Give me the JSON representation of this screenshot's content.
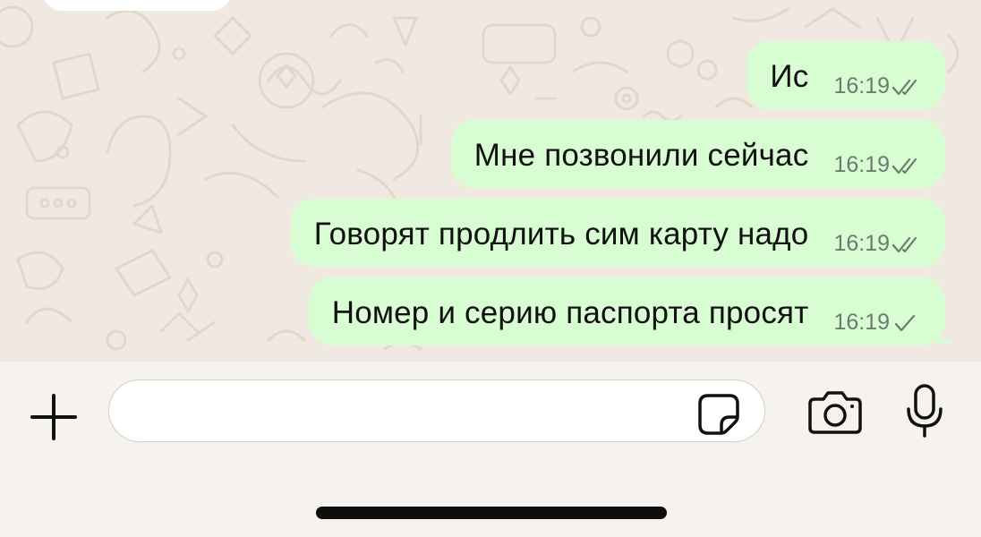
{
  "messages": [
    {
      "text": "Ис",
      "time": "16:19",
      "status": "read"
    },
    {
      "text": "Мне позвонили сейчас",
      "time": "16:19",
      "status": "read"
    },
    {
      "text": "Говорят продлить сим карту надо",
      "time": "16:19",
      "status": "read"
    },
    {
      "text": "Номер и серию паспорта просят",
      "time": "16:19",
      "status": "sent"
    }
  ],
  "composer": {
    "value": "",
    "placeholder": "",
    "icons": {
      "attach": "plus-icon",
      "sticker": "sticker-icon",
      "camera": "camera-icon",
      "microphone": "microphone-icon"
    }
  },
  "colors": {
    "outgoing_bubble": "#d9fdd3",
    "wallpaper": "#efe9e1",
    "input_bar": "#f6f3ef",
    "meta_text": "#6d7b6e"
  }
}
